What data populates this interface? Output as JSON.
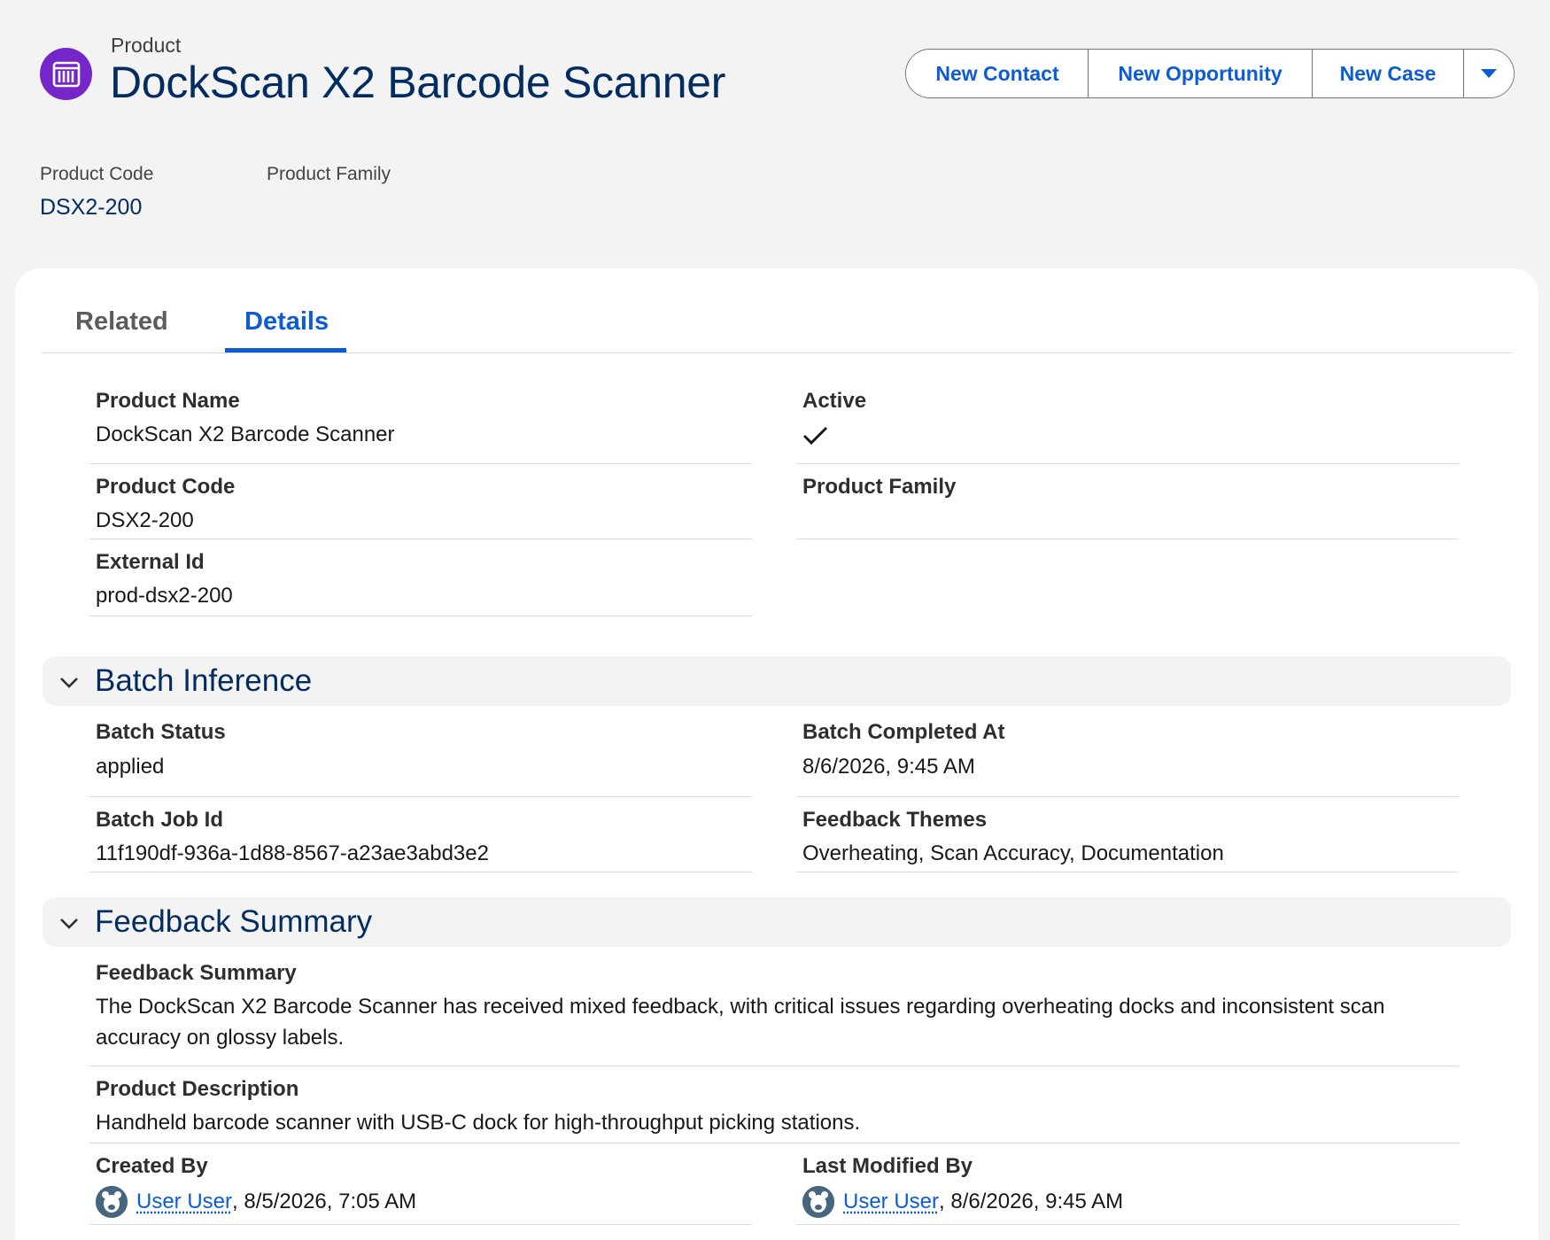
{
  "header": {
    "object_type": "Product",
    "record_title": "DockScan X2 Barcode Scanner",
    "icon": "product-icon",
    "actions": [
      "New Contact",
      "New Opportunity",
      "New Case"
    ],
    "highlights": [
      {
        "label": "Product Code",
        "value": "DSX2-200"
      },
      {
        "label": "Product Family",
        "value": ""
      }
    ]
  },
  "tabs": [
    {
      "label": "Related",
      "active": false
    },
    {
      "label": "Details",
      "active": true
    }
  ],
  "details": {
    "product_name": {
      "label": "Product Name",
      "value": "DockScan X2 Barcode Scanner"
    },
    "active": {
      "label": "Active",
      "checked": true
    },
    "product_code": {
      "label": "Product Code",
      "value": "DSX2-200"
    },
    "product_family": {
      "label": "Product Family",
      "value": ""
    },
    "external_id": {
      "label": "External Id",
      "value": "prod-dsx2-200"
    }
  },
  "batch_section": {
    "title": "Batch Inference",
    "batch_status": {
      "label": "Batch Status",
      "value": "applied"
    },
    "batch_completed_at": {
      "label": "Batch Completed At",
      "value": "8/6/2026, 9:45 AM"
    },
    "batch_job_id": {
      "label": "Batch Job Id",
      "value": "11f190df-936a-1d88-8567-a23ae3abd3e2"
    },
    "feedback_themes": {
      "label": "Feedback Themes",
      "value": "Overheating, Scan Accuracy, Documentation"
    }
  },
  "feedback_section": {
    "title": "Feedback Summary",
    "feedback_summary": {
      "label": "Feedback Summary",
      "value": "The DockScan X2 Barcode Scanner has received mixed feedback, with critical issues regarding overheating docks and inconsistent scan accuracy on glossy labels."
    },
    "product_description": {
      "label": "Product Description",
      "value": "Handheld barcode scanner with USB-C dock for high-throughput picking stations."
    },
    "created_by": {
      "label": "Created By",
      "user": "User User",
      "timestamp": ", 8/5/2026, 7:05 AM"
    },
    "last_modified_by": {
      "label": "Last Modified By",
      "user": "User User",
      "timestamp": ", 8/6/2026, 9:45 AM"
    }
  },
  "colors": {
    "brand_blue": "#0b5cd5",
    "title_navy": "#032d60",
    "product_icon_bg": "#7526c9"
  }
}
